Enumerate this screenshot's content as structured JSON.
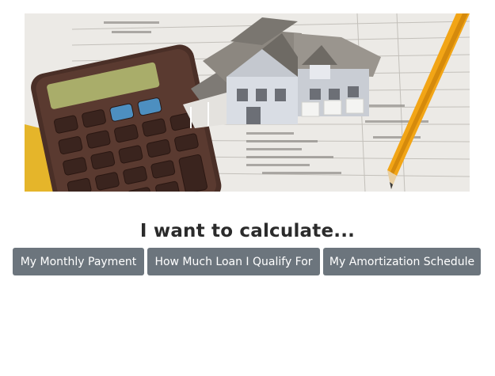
{
  "hero": {
    "image_semantic": "house-model-calculator-tax-form-photo"
  },
  "headline": "I want to calculate...",
  "buttons": [
    {
      "label": "My Monthly Payment"
    },
    {
      "label": "How Much Loan I Qualify For"
    },
    {
      "label": "My Amortization Schedule"
    }
  ],
  "colors": {
    "button_bg": "#6c757d",
    "button_text": "#ffffff",
    "headline_text": "#2b2b2b"
  }
}
